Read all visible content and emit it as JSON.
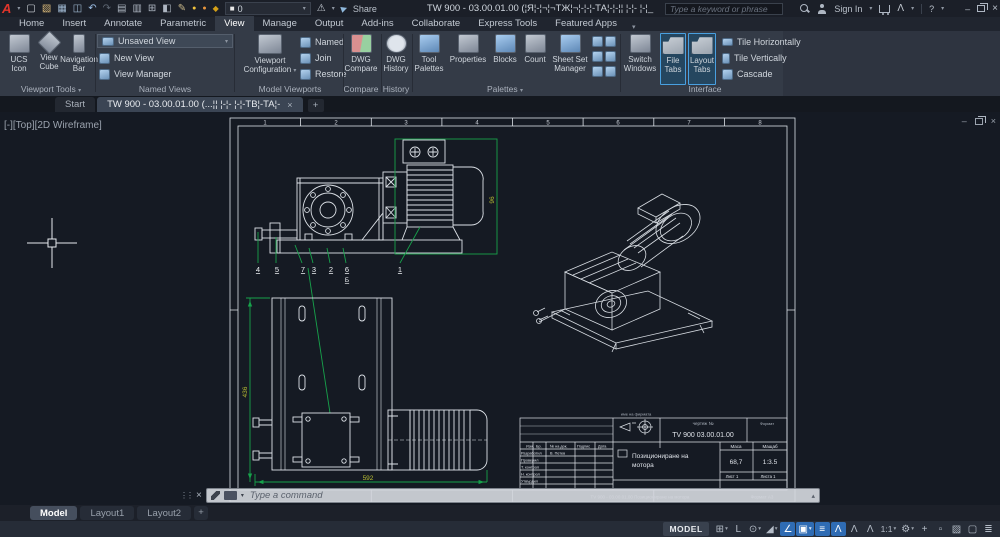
{
  "app": {
    "title": "TW 900 - 03.00.01.00 (¦Я¦-¦¬¦¬ТЖ¦¬¦-¦-¦-ТА¦-¦-¦¦ ¦-¦- ¦-¦_",
    "search_placeholder": "Type a keyword or phrase",
    "sign_in": "Sign In",
    "share": "Share",
    "layer_value": "0"
  },
  "ribbon_tabs": [
    "Home",
    "Insert",
    "Annotate",
    "Parametric",
    "View",
    "Manage",
    "Output",
    "Add-ins",
    "Collaborate",
    "Express Tools",
    "Featured Apps"
  ],
  "panels": {
    "viewport_tools": {
      "label": "Viewport Tools",
      "b1a": "UCS",
      "b1b": "Icon",
      "b2a": "View",
      "b2b": "Cube",
      "b3a": "Navigation",
      "b3b": "Bar"
    },
    "named_views": {
      "label": "Named Views",
      "dropdown": "Unsaved View",
      "new_view": "New View",
      "view_manager": "View Manager"
    },
    "model_viewports": {
      "label": "Model Viewports",
      "biga": "Viewport",
      "bigb": "Configuration",
      "named": "Named",
      "join": "Join",
      "restore": "Restore"
    },
    "compare": {
      "label": "Compare",
      "biga": "DWG",
      "bigb": "Compare"
    },
    "history": {
      "label": "History",
      "biga": "DWG",
      "bigb": "History"
    },
    "palettes": {
      "label": "Palettes",
      "b1a": "Tool",
      "b1b": "Palettes",
      "b2": "Properties",
      "b3": "Blocks",
      "b4": "Count",
      "b5a": "Sheet Set",
      "b5b": "Manager"
    },
    "interface": {
      "label": "Interface",
      "b1a": "Switch",
      "b1b": "Windows",
      "b2a": "File",
      "b2b": "Tabs",
      "b3a": "Layout",
      "b3b": "Tabs",
      "tile_h": "Tile Horizontally",
      "tile_v": "Tile Vertically",
      "cascade": "Cascade"
    }
  },
  "file_tabs": {
    "start": "Start",
    "doc": "TW 900 - 03.00.01.00 (...¦¦ ¦-¦- ¦-¦-TB¦-TA¦-"
  },
  "viewport_label": "[-][Top][2D Wireframe]",
  "sheet": {
    "zones_top": [
      "1",
      "2",
      "3",
      "4",
      "5",
      "6",
      "7",
      "8"
    ],
    "callouts": {
      "c4": "4",
      "c5": "5",
      "c7": "7",
      "c3": "3",
      "c2": "2",
      "c6": "6",
      "c1": "1",
      "section": "Б"
    },
    "dims": {
      "width": "592",
      "height": "436",
      "motor": "96"
    },
    "tb": {
      "firm": "име на фирмата",
      "doc_label": "чертеж №",
      "part_no": "TV 900   03.00.01.00",
      "format_label": "Формат",
      "title1": "Позициониране на",
      "title2": "мотора",
      "mass_label": "Маса",
      "mass": "68,7",
      "scale_label": "Мащаб",
      "scale": "1:3.5",
      "h1": "Изм.",
      "h2": "Бр.",
      "h3": "№ на док.",
      "h4": "Подпис",
      "h5": "Дата",
      "r1": "Разработил",
      "r1v": "В. Петев",
      "r2": "Проверил",
      "r3": "Т. контрол",
      "r4": "Н. контрол",
      "r5": "Утвърдил",
      "sheet_no": "Лист 1",
      "sheets": "Листа 1",
      "footer": "TV 900 - 03.00.01.00   Позициониране на мотора",
      "footer_format": "Формат A3"
    }
  },
  "command": {
    "placeholder": "Type a command"
  },
  "layout_tabs": {
    "model": "Model",
    "l1": "Layout1",
    "l2": "Layout2"
  },
  "status": {
    "model": "MODEL",
    "scale": "1:1"
  },
  "icons": {
    "caret": "▾",
    "minimize": "–",
    "close": "×",
    "x": "×",
    "up": "▴",
    "handle": "⋮⋮",
    "grid": "⊞",
    "ortho": "L",
    "polar": "⊙",
    "isodraft": "◢",
    "otrack": "∠",
    "osnap": "▣",
    "lineweight": "≡",
    "ann": "Ʌ",
    "gear": "⚙",
    "plus": "+",
    "isolate": "▫",
    "perf": "▨",
    "clean": "▢",
    "menu": "≣",
    "new": "▢",
    "open": "▧",
    "save": "▦",
    "saveall": "◫",
    "undo": "↶",
    "redo": "↷",
    "print": "▤",
    "preview": "▥",
    "panels": "⊞",
    "cube": "◧",
    "edit": "✎",
    "bulb": "●",
    "lock": "◆",
    "swatch": "■",
    "warning": "⚠",
    "adsk": "Λ",
    "help": "?",
    "share_arrow": "▶",
    "logo": "A"
  }
}
